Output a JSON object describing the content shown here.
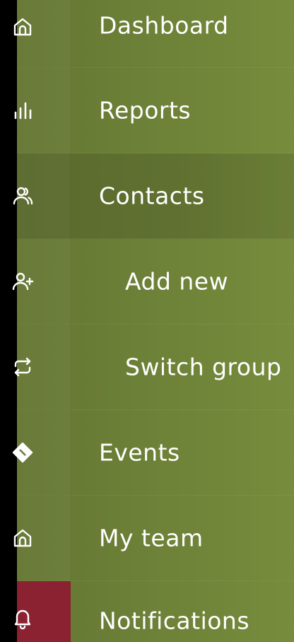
{
  "menu": {
    "items": [
      {
        "label": "Dashboard",
        "icon": "home-icon"
      },
      {
        "label": "Reports",
        "icon": "bar-chart-icon"
      },
      {
        "label": "Contacts",
        "icon": "users-icon",
        "active": true
      },
      {
        "label": "Add new",
        "icon": "user-plus-icon",
        "submenu": true
      },
      {
        "label": "Switch group",
        "icon": "repeat-icon",
        "submenu": true
      },
      {
        "label": "Events",
        "icon": "ticket-icon"
      },
      {
        "label": "My team",
        "icon": "home-icon"
      },
      {
        "label": "Notifications",
        "icon": "bell-icon",
        "alert": true
      }
    ]
  },
  "colors": {
    "menu_background": "#6c7f37",
    "active_row": "#5c6d2e",
    "alert_icon_background": "#8a2232",
    "text": "#ffffff"
  }
}
